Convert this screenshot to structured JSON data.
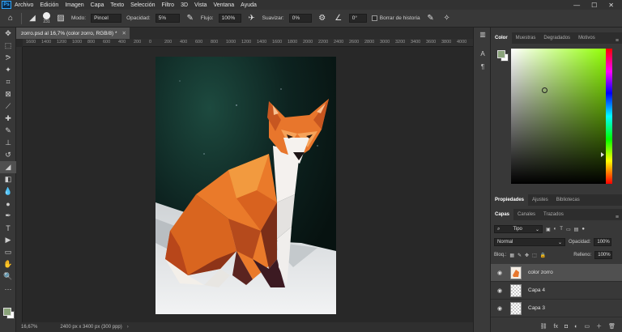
{
  "menu": {
    "items": [
      "Archivo",
      "Edición",
      "Imagen",
      "Capa",
      "Texto",
      "Selección",
      "Filtro",
      "3D",
      "Vista",
      "Ventana",
      "Ayuda"
    ],
    "logo": "Ps"
  },
  "options_bar": {
    "brush_size": "231",
    "mode_label": "Modo:",
    "mode_value": "Pincel",
    "opacity_label": "Opacidad:",
    "opacity_value": "5%",
    "flow_label": "Flujo:",
    "flow_value": "100%",
    "smoothing_label": "Suavizar:",
    "smoothing_value": "0%",
    "angle_value": "0°",
    "erase_history_label": "Borrar de historia"
  },
  "document": {
    "tab_title": "zorro.psd al 16,7% (color zorro, RGB/8) *",
    "zoom": "16,67%",
    "doc_info": "2400 px x 3400 px (300 ppp)",
    "ruler_marks": [
      "1600",
      "1400",
      "1200",
      "1000",
      "800",
      "600",
      "400",
      "200",
      "0",
      "200",
      "400",
      "600",
      "800",
      "1000",
      "1200",
      "1400",
      "1600",
      "1800",
      "2000",
      "2200",
      "2400",
      "2600",
      "2800",
      "3000",
      "3200",
      "3400",
      "3600",
      "3800",
      "4000"
    ]
  },
  "color_panel": {
    "tabs": [
      "Color",
      "Muestras",
      "Degradados",
      "Motivos"
    ],
    "foreground": "#8aa37a",
    "background": "#ffffff",
    "hue": "#8fff00"
  },
  "properties_panel": {
    "tabs": [
      "Propiedades",
      "Ajustes",
      "Bibliotecas"
    ]
  },
  "layers_panel": {
    "tabs": [
      "Capas",
      "Canales",
      "Trazados"
    ],
    "filter_value": "Tipo",
    "blend_mode": "Normal",
    "opacity_label": "Opacidad:",
    "opacity_value": "100%",
    "lock_label": "Bloq.:",
    "fill_label": "Relleno:",
    "fill_value": "100%",
    "layers": [
      {
        "name": "color zorro",
        "selected": true
      },
      {
        "name": "Capa 4",
        "selected": false
      },
      {
        "name": "Capa 3",
        "selected": false
      }
    ]
  },
  "colors": {
    "app_bg": "#282828",
    "panel_bg": "#383838",
    "fox_orange": "#e8742a",
    "night_sky": "#0d1f1c"
  }
}
